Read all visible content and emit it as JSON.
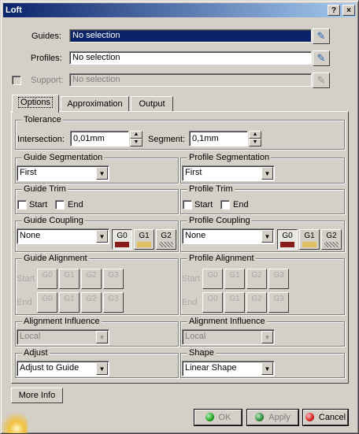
{
  "window": {
    "title": "Loft",
    "help_glyph": "?",
    "close_glyph": "×"
  },
  "fields": {
    "guides_label": "Guides:",
    "guides_value": "No selection",
    "profiles_label": "Profiles:",
    "profiles_value": "No selection",
    "support_label": "Support:",
    "support_value": "No selection"
  },
  "tabs": [
    {
      "label": "Options"
    },
    {
      "label": "Approximation"
    },
    {
      "label": "Output"
    }
  ],
  "tolerance": {
    "title": "Tolerance",
    "intersection_label": "Intersection:",
    "intersection_value": "0,01mm",
    "segment_label": "Segment:",
    "segment_value": "0,1mm"
  },
  "guide_segmentation": {
    "title": "Guide Segmentation",
    "value": "First"
  },
  "profile_segmentation": {
    "title": "Profile Segmentation",
    "value": "First"
  },
  "guide_trim": {
    "title": "Guide Trim",
    "start": "Start",
    "end": "End"
  },
  "profile_trim": {
    "title": "Profile Trim",
    "start": "Start",
    "end": "End"
  },
  "guide_coupling": {
    "title": "Guide Coupling",
    "value": "None"
  },
  "profile_coupling": {
    "title": "Profile Coupling",
    "value": "None"
  },
  "continuity": {
    "g0": "G0",
    "g1": "G1",
    "g2": "G2",
    "g3": "G3"
  },
  "guide_alignment": {
    "title": "Guide Alignment",
    "start": "Start",
    "end": "End"
  },
  "profile_alignment": {
    "title": "Profile Alignment",
    "start": "Start",
    "end": "End"
  },
  "guide_influence": {
    "title": "Alignment Influence",
    "value": "Local"
  },
  "profile_influence": {
    "title": "Alignment Influence",
    "value": "Local"
  },
  "adjust": {
    "title": "Adjust",
    "value": "Adjust to Guide"
  },
  "shape": {
    "title": "Shape",
    "value": "Linear Shape"
  },
  "buttons": {
    "more_info": "More Info",
    "ok": "OK",
    "apply": "Apply",
    "cancel": "Cancel"
  },
  "icons": {
    "selector": "pointer-icon",
    "combo_arrow": "▼",
    "spin_up": "▲",
    "spin_down": "▼"
  },
  "colors": {
    "title_gradient_start": "#0a246a",
    "title_gradient_end": "#a6caf0",
    "g0_swatch": "#8b1a1a",
    "ok_dot": "#1ea01e",
    "apply_dot": "#2a8a3a",
    "cancel_dot": "#d42020"
  }
}
